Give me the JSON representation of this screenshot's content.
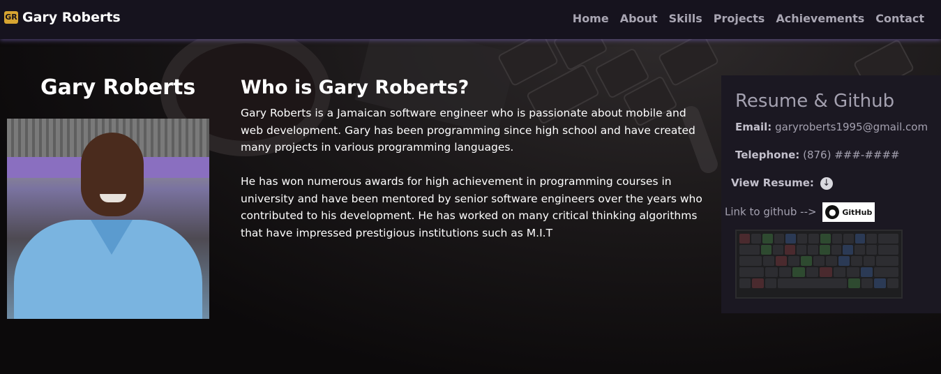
{
  "navbar": {
    "logo_text": "GR",
    "brand": "Gary Roberts",
    "links": [
      "Home",
      "About",
      "Skills",
      "Projects",
      "Achievements",
      "Contact"
    ]
  },
  "profile": {
    "name": "Gary Roberts"
  },
  "bio": {
    "title": "Who is Gary Roberts?",
    "paragraphs": [
      "Gary Roberts is a Jamaican software engineer who is passionate about mobile and web development. Gary has been programming since high school and have created many projects in various programming languages.",
      "He has won numerous awards for high achievement in programming courses in university and have been mentored by senior software engineers over the years who contributed to his development. He has worked on many critical thinking algorithms that have impressed prestigious institutions such as M.I.T"
    ]
  },
  "resume": {
    "title": "Resume & Github",
    "email_label": "Email:",
    "email": "garyroberts1995@gmail.com",
    "phone_label": "Telephone:",
    "phone": "(876) ###-####",
    "view_resume_label": "View Resume:",
    "github_label": "Link to github -->",
    "github_badge": "GitHub"
  },
  "icons": {
    "download": "download-icon",
    "github": "github-icon"
  },
  "colors": {
    "nav_bg": "#16131e",
    "nav_link": "#a9a6b3",
    "card_bg": "#1b1822",
    "logo_accent": "#d7a531"
  }
}
